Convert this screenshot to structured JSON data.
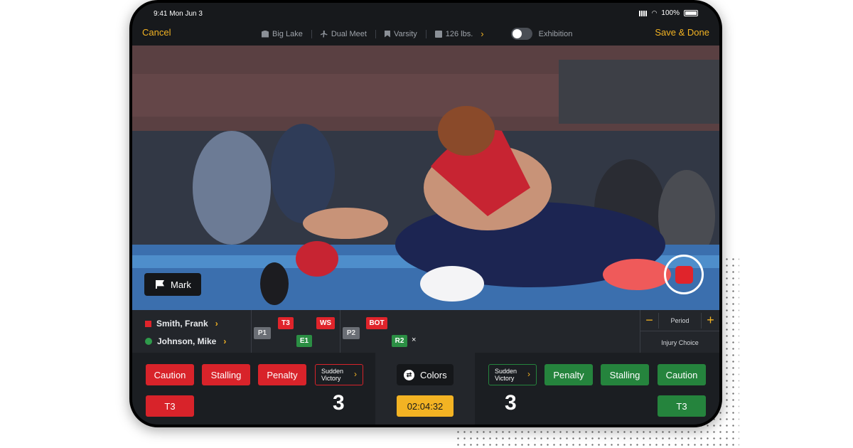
{
  "status": {
    "time": "9:41 Mon Jun 3",
    "battery": "100%"
  },
  "nav": {
    "cancel": "Cancel",
    "save": "Save & Done",
    "location": "Big Lake",
    "meet_type": "Dual Meet",
    "level": "Varsity",
    "weight": "126 lbs.",
    "exhibition_label": "Exhibition",
    "exhibition_on": false
  },
  "video": {
    "mark_label": "Mark"
  },
  "wrestlers": {
    "red": {
      "name": "Smith, Frank",
      "color": "#e0242b"
    },
    "green": {
      "name": "Johnson, Mike",
      "color": "#2f9b4b"
    }
  },
  "timeline": {
    "p1": "P1",
    "p2": "P2",
    "red_events": [
      "T3",
      "WS",
      "BOT"
    ],
    "green_events": [
      "E1",
      "R2"
    ],
    "remove_mark": "×"
  },
  "period": {
    "label": "Period",
    "minus": "−",
    "plus": "+",
    "injury": "Injury Choice"
  },
  "controls": {
    "red": {
      "caution": "Caution",
      "stalling": "Stalling",
      "penalty": "Penalty",
      "sudden_line1": "Sudden",
      "sudden_line2": "Victory",
      "t3": "T3",
      "score": "3"
    },
    "green": {
      "caution": "Caution",
      "stalling": "Stalling",
      "penalty": "Penalty",
      "sudden_line1": "Sudden",
      "sudden_line2": "Victory",
      "t3": "T3",
      "score": "3"
    },
    "colors_label": "Colors",
    "clock": "02:04:32"
  },
  "accent": "#f3b323"
}
